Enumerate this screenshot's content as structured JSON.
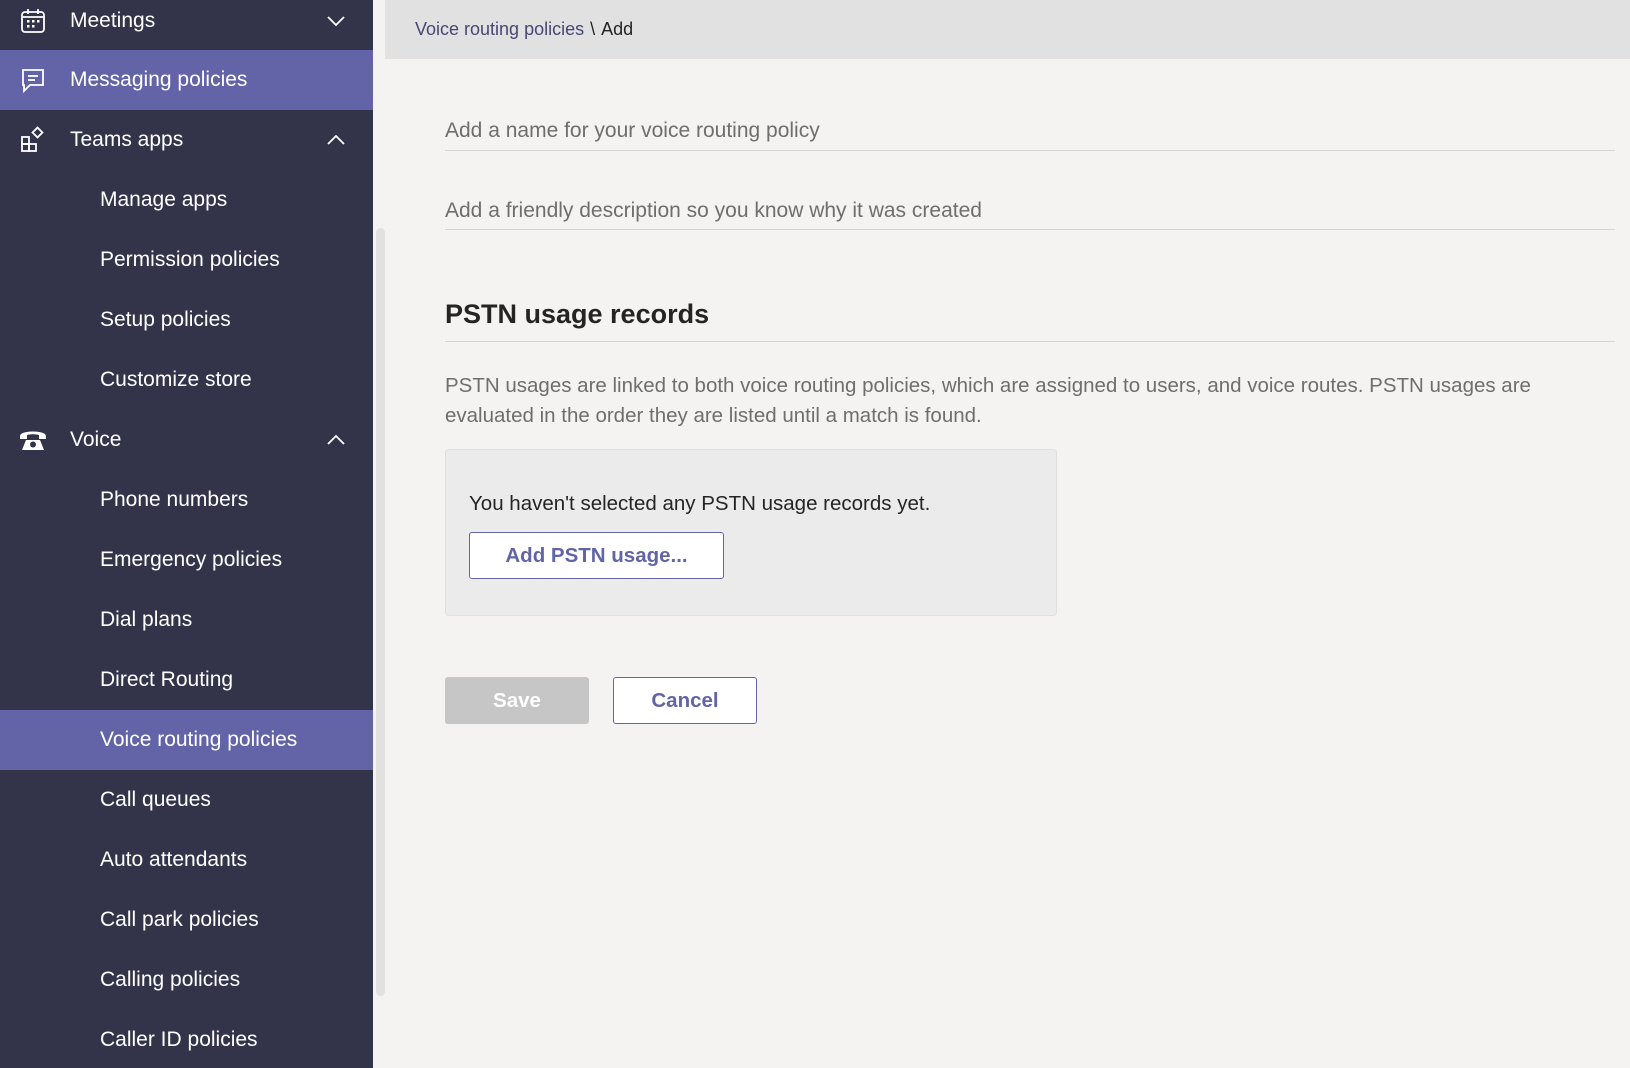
{
  "sidebar": {
    "meetings": "Meetings",
    "messaging_policies": "Messaging policies",
    "teams_apps": "Teams apps",
    "manage_apps": "Manage apps",
    "permission_policies": "Permission policies",
    "setup_policies": "Setup policies",
    "customize_store": "Customize store",
    "voice": "Voice",
    "phone_numbers": "Phone numbers",
    "emergency_policies": "Emergency policies",
    "dial_plans": "Dial plans",
    "direct_routing": "Direct Routing",
    "voice_routing_policies": "Voice routing policies",
    "call_queues": "Call queues",
    "auto_attendants": "Auto attendants",
    "call_park_policies": "Call park policies",
    "calling_policies": "Calling policies",
    "caller_id_policies": "Caller ID policies",
    "icons": {
      "meetings": "calendar-icon",
      "messaging_policies": "message-icon",
      "teams_apps": "apps-icon",
      "voice": "phone-icon"
    }
  },
  "breadcrumb": {
    "parent": "Voice routing policies",
    "separator": "\\",
    "current": "Add"
  },
  "form": {
    "name_placeholder": "Add a name for your voice routing policy",
    "name_value": "",
    "description_placeholder": "Add a friendly description so you know why it was created",
    "description_value": ""
  },
  "pstn": {
    "title": "PSTN usage records",
    "description": "PSTN usages are linked to both voice routing policies, which are assigned to users, and voice routes. PSTN usages are evaluated in the order they are listed until a match is found.",
    "empty_text": "You haven't selected any PSTN usage records yet.",
    "add_button": "Add PSTN usage..."
  },
  "actions": {
    "save": "Save",
    "cancel": "Cancel"
  },
  "colors": {
    "sidebar_bg": "#33344a",
    "accent": "#6264a7",
    "page_bg": "#f4f3f1",
    "header_bg": "#e1e1e1"
  }
}
